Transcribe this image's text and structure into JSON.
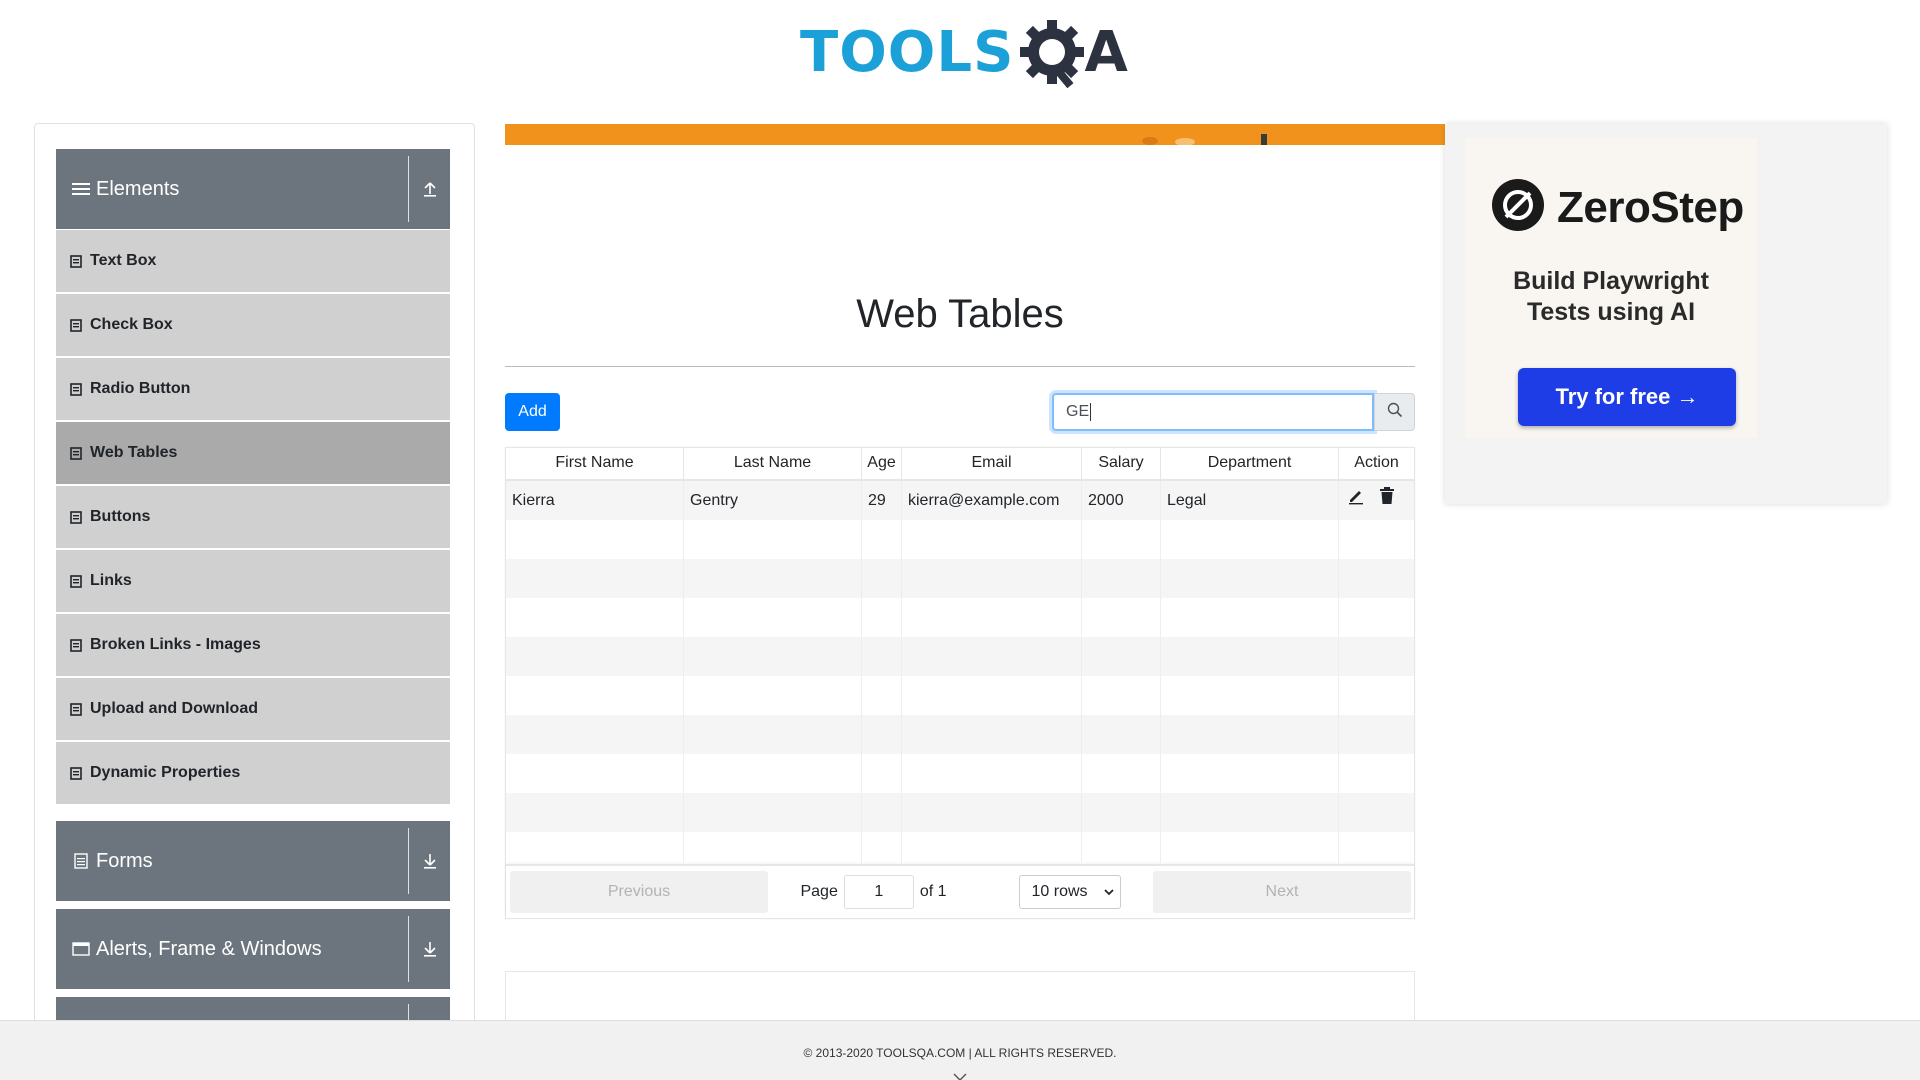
{
  "header": {
    "logo_text": "TOOLS",
    "logo_suffix": "A",
    "logo_alt": "TOOLSQA"
  },
  "sidebar": {
    "groups": [
      {
        "title": "Elements",
        "icon": "hamburger-icon",
        "toggle": "collapse-up-icon",
        "expanded": true
      },
      {
        "title": "Forms",
        "icon": "document-icon",
        "toggle": "expand-down-icon",
        "expanded": false
      },
      {
        "title": "Alerts, Frame & Windows",
        "icon": "window-icon",
        "toggle": "expand-down-icon",
        "expanded": false
      }
    ],
    "items": [
      {
        "label": "Text Box",
        "active": false
      },
      {
        "label": "Check Box",
        "active": false
      },
      {
        "label": "Radio Button",
        "active": false
      },
      {
        "label": "Web Tables",
        "active": true
      },
      {
        "label": "Buttons",
        "active": false
      },
      {
        "label": "Links",
        "active": false
      },
      {
        "label": "Broken Links - Images",
        "active": false
      },
      {
        "label": "Upload and Download",
        "active": false
      },
      {
        "label": "Dynamic Properties",
        "active": false
      }
    ]
  },
  "main": {
    "title": "Web Tables",
    "add_label": "Add",
    "search_value": "GE",
    "table": {
      "columns": [
        "First Name",
        "Last Name",
        "Age",
        "Email",
        "Salary",
        "Department",
        "Action"
      ],
      "rows": [
        {
          "first": "Kierra",
          "last": "Gentry",
          "age": "29",
          "email": "kierra@example.com",
          "salary": "2000",
          "department": "Legal"
        }
      ]
    },
    "pagination": {
      "previous": "Previous",
      "page_label": "Page",
      "page_value": "1",
      "of_label": "of 1",
      "rows_select": "10 rows",
      "next": "Next"
    }
  },
  "ad": {
    "brand": "ZeroStep",
    "tagline_line1": "Build Playwright",
    "tagline_line2": "Tests using AI",
    "cta": "Try for free →",
    "accent": "#1e3de6"
  },
  "footer": {
    "text": "© 2013-2020 TOOLSQA.COM | ALL RIGHTS RESERVED."
  },
  "colors": {
    "primary": "#007bff",
    "sidebar_header": "#6c757d",
    "menu_item": "#d0d0d0",
    "menu_active": "#aaaaaa",
    "logo_blue": "#1ba1d8"
  }
}
